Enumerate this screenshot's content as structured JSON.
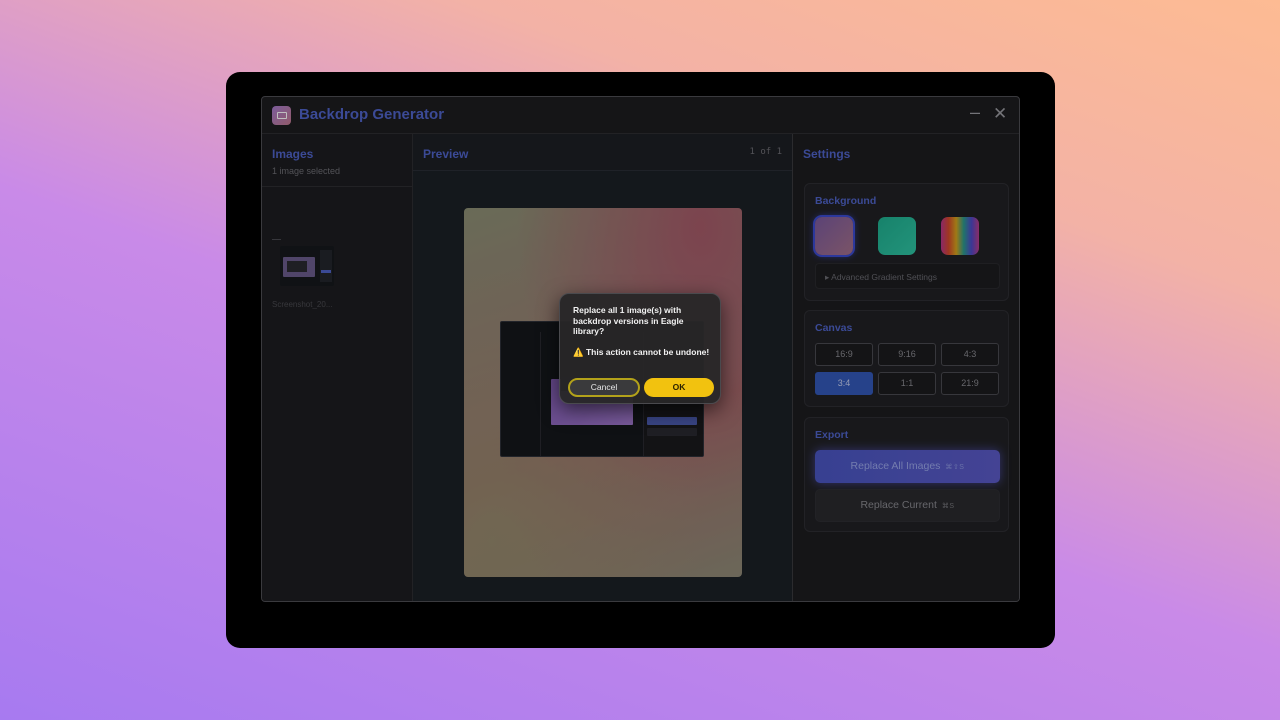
{
  "window": {
    "title": "Backdrop Generator",
    "minimize_glyph": "–",
    "close_glyph": "✕"
  },
  "images_panel": {
    "title": "Images",
    "subtitle": "1 image selected",
    "thumbnail_name": "Screenshot_20..."
  },
  "preview_panel": {
    "title": "Preview",
    "page_count": "1 of 1"
  },
  "settings_panel": {
    "title": "Settings",
    "background": {
      "title": "Background",
      "swatches": [
        "purple-rose-gradient",
        "teal-gradient",
        "rainbow-gradient"
      ],
      "selected_swatch": "purple-rose-gradient",
      "advanced_label": "▸  Advanced Gradient Settings"
    },
    "canvas": {
      "title": "Canvas",
      "ratios": [
        "16:9",
        "9:16",
        "4:3",
        "3:4",
        "1:1",
        "21:9"
      ],
      "selected": "3:4"
    },
    "export": {
      "title": "Export",
      "replace_all_label": "Replace All Images",
      "replace_all_shortcut": "⌘⇧S",
      "replace_current_label": "Replace Current",
      "replace_current_shortcut": "⌘S"
    }
  },
  "dialog": {
    "message": "Replace all 1 image(s) with backdrop versions in Eagle library?",
    "warning": "⚠️ This action cannot be undone!",
    "cancel_label": "Cancel",
    "ok_label": "OK"
  },
  "colors": {
    "accent": "#4f63c9",
    "ok_button": "#f2c20f",
    "selected_ratio": "#3358b8"
  }
}
